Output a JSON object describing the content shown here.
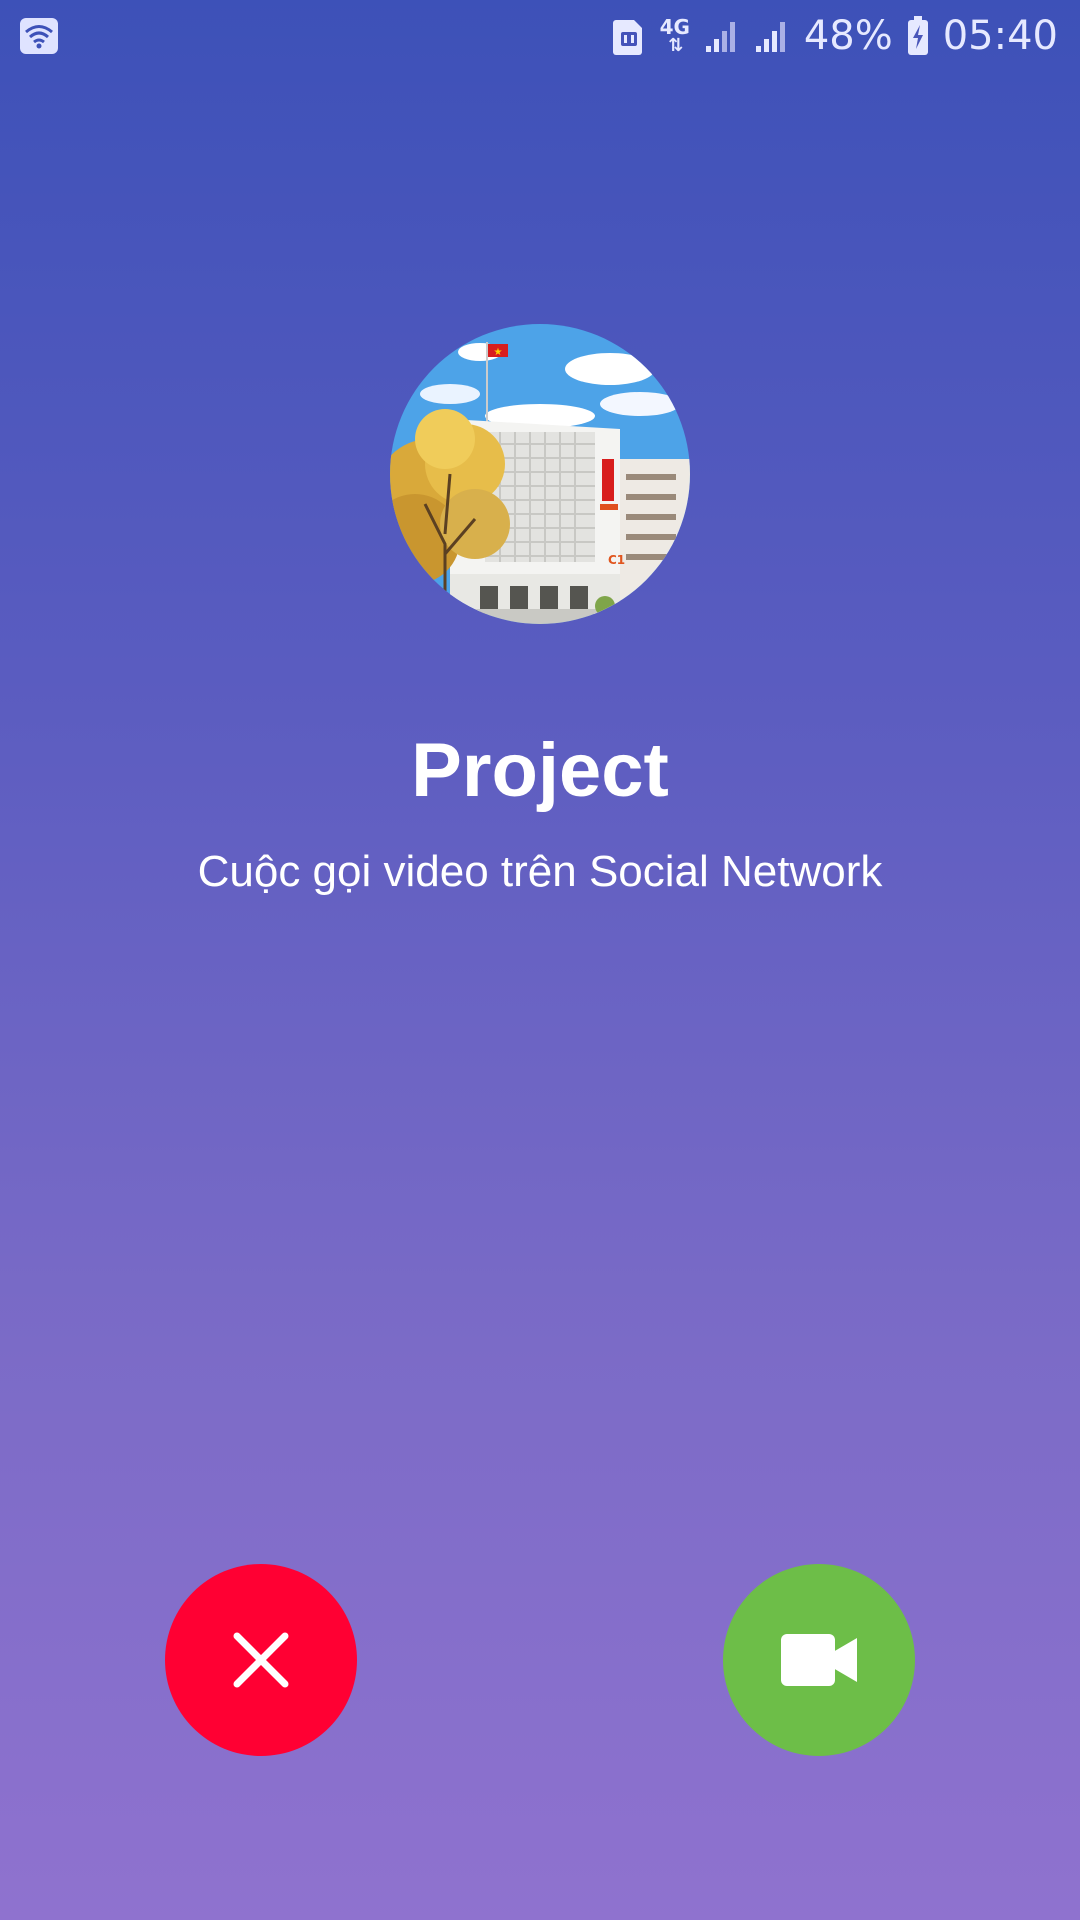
{
  "status_bar": {
    "battery_percent": "48%",
    "time": "05:40",
    "network_type": "4G",
    "icons": [
      "wifi-icon",
      "sim-card-icon",
      "network-4g-icon",
      "signal-1-icon",
      "signal-2-icon",
      "battery-charging-icon"
    ]
  },
  "call": {
    "caller_name": "Project",
    "subtitle": "Cuộc gọi video trên Social Network",
    "avatar": "building-photo"
  },
  "actions": {
    "decline": {
      "icon": "close-icon",
      "color": "#ff0033"
    },
    "accept": {
      "icon": "video-camera-icon",
      "color": "#6dbe48"
    }
  },
  "colors": {
    "gradient_top": "#3d51b8",
    "gradient_bottom": "#8f72cf"
  }
}
